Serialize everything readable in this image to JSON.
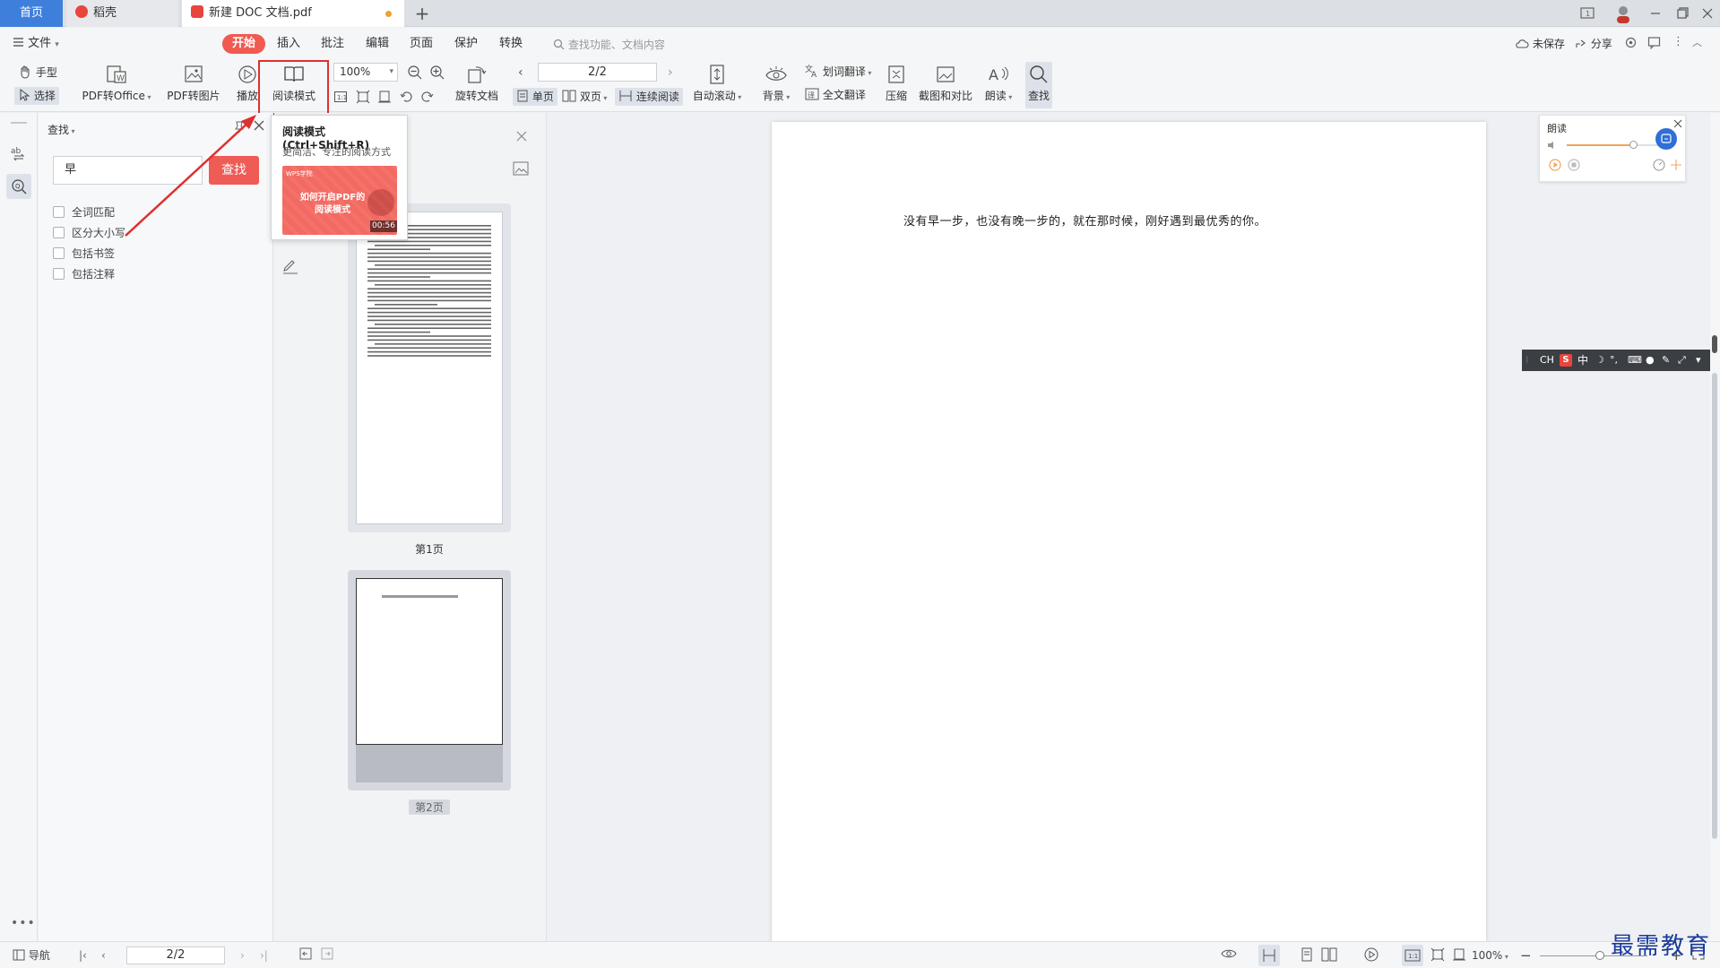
{
  "tabs": {
    "home": "首页",
    "daoke": "稻壳",
    "doc": "新建 DOC 文档.pdf"
  },
  "menu": {
    "file": "文件",
    "items": [
      "开始",
      "插入",
      "批注",
      "编辑",
      "页面",
      "保护",
      "转换"
    ],
    "search_placeholder": "查找功能、文档内容",
    "unsaved": "未保存",
    "share": "分享"
  },
  "toolbar": {
    "hand": "手型",
    "select": "选择",
    "pdf_to_office": "PDF转Office",
    "pdf_to_image": "PDF转图片",
    "play": "播放",
    "reading_mode": "阅读模式",
    "zoom": "100%",
    "rotate": "旋转文档",
    "page": "2/2",
    "single": "单页",
    "double": "双页",
    "continuous": "连续阅读",
    "auto_scroll": "自动滚动",
    "background": "背景",
    "word_translate": "划词翻译",
    "full_translate": "全文翻译",
    "compress": "压缩",
    "screenshot": "截图和对比",
    "read_aloud": "朗读",
    "find": "查找"
  },
  "tooltip": {
    "title": "阅读模式 (Ctrl+Shift+R)",
    "desc": "更简洁、专注的阅读方式",
    "video_brand": "WPS学院",
    "video_title_1": "如何开启PDF的",
    "video_title_2": "阅读模式",
    "duration": "00:56"
  },
  "find_panel": {
    "title": "查找",
    "query": "早",
    "button": "查找",
    "options": [
      "全词匹配",
      "区分大小写",
      "包括书签",
      "包括注释"
    ]
  },
  "thumbnails": [
    {
      "label": "第1页"
    },
    {
      "label": "第2页"
    }
  ],
  "document": {
    "text": "没有早一步，也没有晚一步的，就在那时候，刚好遇到最优秀的你。"
  },
  "tts": {
    "title": "朗读",
    "volume": 0.62
  },
  "ime": {
    "lang": "CH",
    "mode": "中"
  },
  "status": {
    "nav": "导航",
    "page": "2/2",
    "zoom": "100%"
  },
  "watermark": "最需教育",
  "colors": {
    "accent_red": "#ef5b55",
    "tab_blue": "#3f7fdc",
    "annotation_red": "#e02f2f"
  }
}
